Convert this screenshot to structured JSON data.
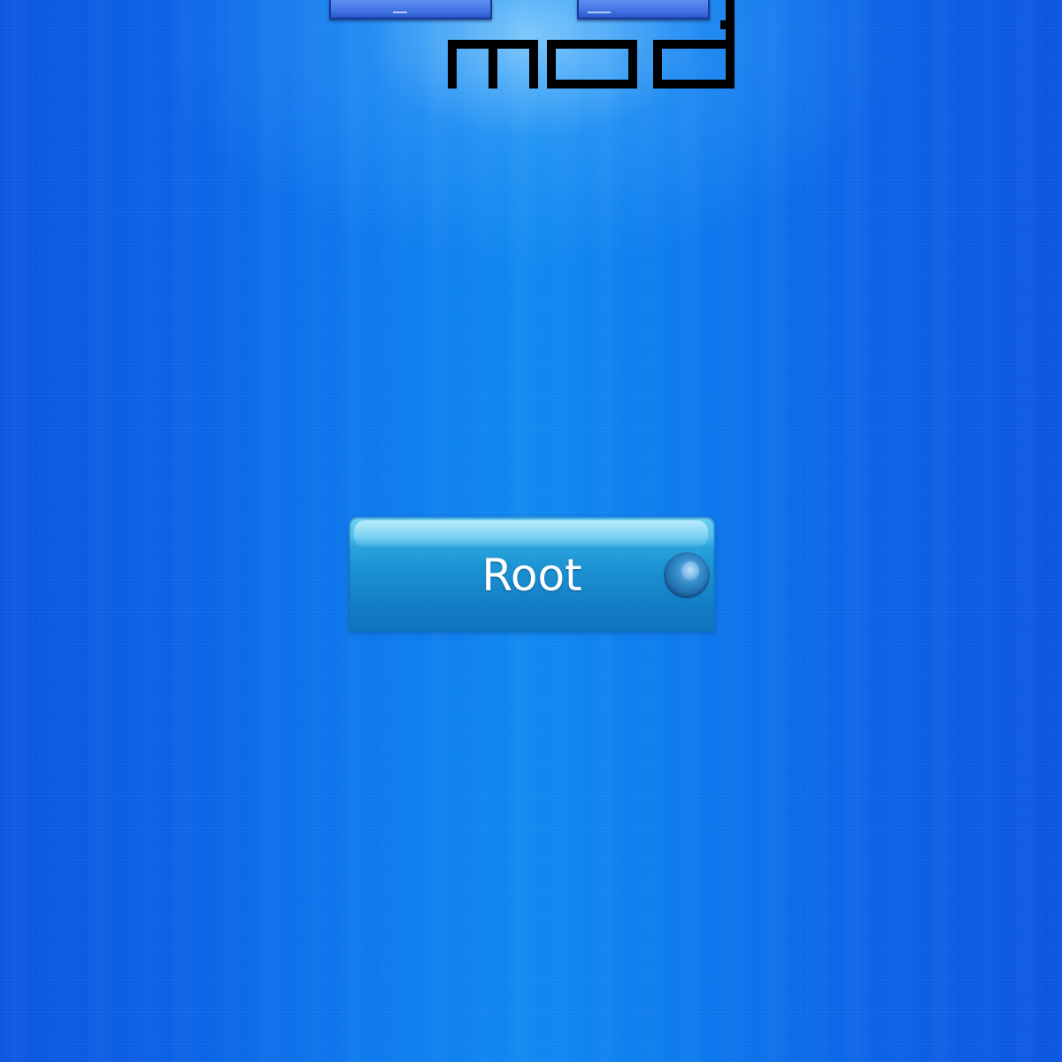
{
  "logo": {
    "text": "mod",
    "icon": "mod-logo"
  },
  "root_button": {
    "label": "Root",
    "icon": "bubble-icon"
  },
  "colors": {
    "background": "#0a6be6",
    "button_top": "#6fd0f2",
    "button_bottom": "#0f74bf",
    "label": "#ffffff",
    "logo": "#000000"
  }
}
